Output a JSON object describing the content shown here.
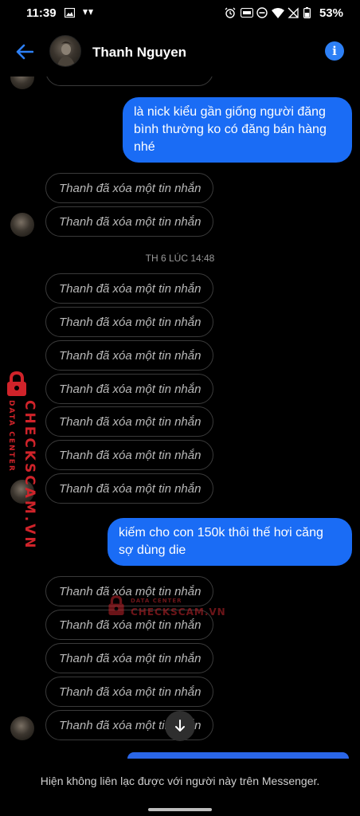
{
  "status_bar": {
    "time": "11:39",
    "battery_percent": "53%",
    "left_icons": [
      "gallery-icon",
      "app-icon"
    ],
    "right_icons": [
      "alarm-icon",
      "volte-icon",
      "dnd-icon",
      "wifi-icon",
      "no-signal-icon",
      "battery-icon"
    ]
  },
  "header": {
    "contact_name": "Thanh Nguyen",
    "back_icon": "arrow-left-icon",
    "info_icon": "info-icon",
    "info_glyph": "i"
  },
  "messages": {
    "deleted_text": "Thanh đã xóa một tin nhắn",
    "outgoing_1": "là nick kiểu gần giống người đăng bình thường ko có đăng bán hàng nhé",
    "outgoing_2": "kiếm cho con 150k thôi thế hơi căng sợ dùng die",
    "timestamp_1": "TH 6 LÚC 14:48"
  },
  "footer": {
    "notice": "Hiện không liên lạc được với người này trên Messenger."
  },
  "watermark": {
    "main": "CHECKSCAM.VN",
    "sub": "DATA CENTER"
  },
  "colors": {
    "accent": "#1a6cf5",
    "info_button": "#2d80f6",
    "background": "#000000",
    "deleted_text": "#b9b9b9",
    "watermark": "#d0232a"
  }
}
